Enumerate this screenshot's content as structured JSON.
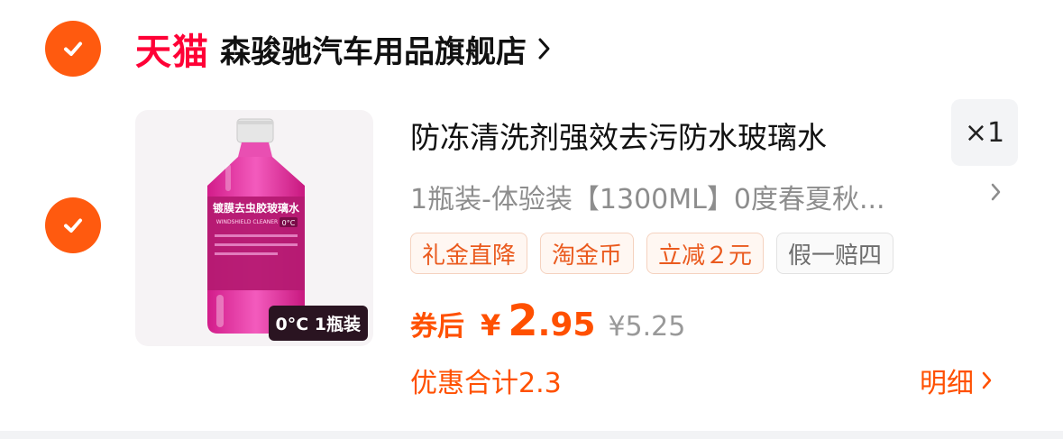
{
  "store": {
    "selected": true,
    "brand_logo_text": "天猫",
    "name": "森骏驰汽车用品旗舰店",
    "arrow_icon": "chevron-right-icon"
  },
  "item": {
    "selected": true,
    "image": {
      "description_text": "镀膜去虫胶玻璃水",
      "sub_text": "WINDSHIELD CLEANER",
      "badge": "0°C 1瓶装",
      "temp_tag": "0°C"
    },
    "title": "防冻清洗剂强效去污防水玻璃水",
    "quantity": "×1",
    "sku": "1瓶装-体验装【1300ML】0度春夏秋...",
    "tags": [
      "礼金直降",
      "淘金币",
      "立减２元",
      "假一赔四"
    ],
    "price": {
      "label": "券后",
      "currency": "¥",
      "integer": "2",
      "decimal": ".95",
      "original": "¥5.25"
    },
    "discount_total": "优惠合计2.3",
    "detail_label": "明细"
  },
  "colors": {
    "accent": "#ff5000",
    "check": "#ff5a0f",
    "tmall_red": "#ff0036"
  }
}
